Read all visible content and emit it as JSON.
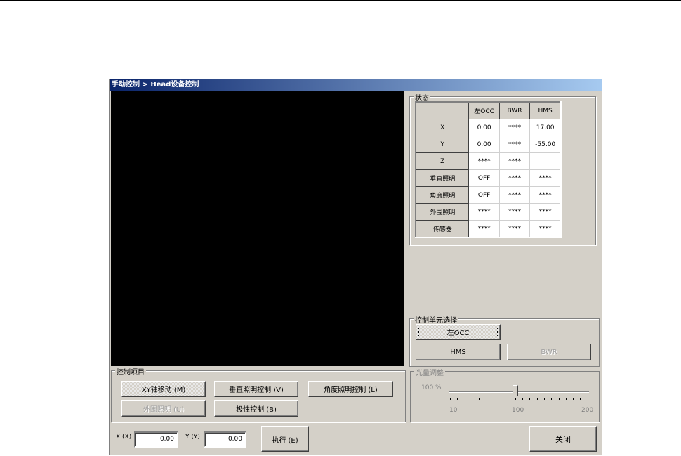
{
  "title": "手动控制 > Head设备控制",
  "status": {
    "legend": "状态",
    "columns": [
      "",
      "左OCC",
      "BWR",
      "HMS"
    ],
    "rows": [
      {
        "label": "X",
        "values": [
          "0.00",
          "****",
          "17.00"
        ]
      },
      {
        "label": "Y",
        "values": [
          "0.00",
          "****",
          "-55.00"
        ]
      },
      {
        "label": "Z",
        "values": [
          "****",
          "****",
          ""
        ]
      },
      {
        "label": "垂直照明",
        "values": [
          "OFF",
          "****",
          "****"
        ]
      },
      {
        "label": "角度照明",
        "values": [
          "OFF",
          "****",
          "****"
        ]
      },
      {
        "label": "外围照明",
        "values": [
          "****",
          "****",
          "****"
        ]
      },
      {
        "label": "传感器",
        "values": [
          "****",
          "****",
          "****"
        ]
      }
    ]
  },
  "unit_select": {
    "legend": "控制单元选择",
    "left_occ": "左OCC",
    "hms": "HMS",
    "bwr": "BWR"
  },
  "light": {
    "legend": "光量调整",
    "value_label": "100 %",
    "value": 100,
    "min": 10,
    "max": 200,
    "tick_labels": [
      "10",
      "100",
      "200"
    ]
  },
  "control_items": {
    "legend": "控制项目",
    "xy_move": "XY轴移动 (M)",
    "vertical_light": "垂直照明控制 (V)",
    "angle_light": "角度照明控制 (L)",
    "outer_light": "外围照明 (U)",
    "polarity": "极性控制 (B)"
  },
  "coords": {
    "x_label": "X (X)",
    "x_value": "0.00",
    "y_label": "Y (Y)",
    "y_value": "0.00",
    "execute": "执行 (E)"
  },
  "close": "关闭"
}
